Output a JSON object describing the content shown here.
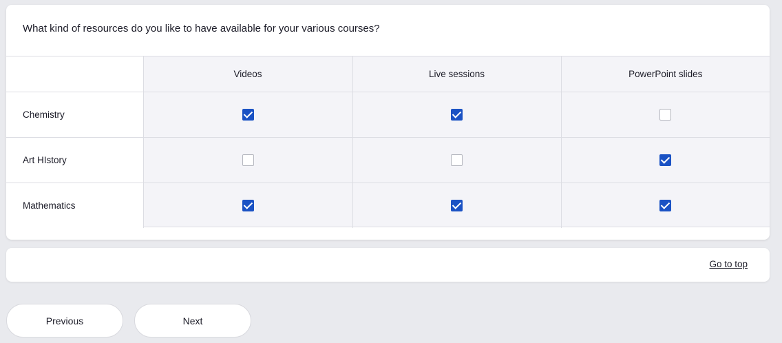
{
  "question": {
    "title": "What kind of resources do you like to have available for your various courses?"
  },
  "matrix": {
    "columns": [
      "Videos",
      "Live sessions",
      "PowerPoint slides"
    ],
    "rows": [
      {
        "label": "Chemistry",
        "values": [
          true,
          true,
          false
        ]
      },
      {
        "label": "Art HIstory",
        "values": [
          false,
          false,
          true
        ]
      },
      {
        "label": "Mathematics",
        "values": [
          true,
          true,
          true
        ]
      }
    ]
  },
  "footer": {
    "go_to_top": "Go to top"
  },
  "navigation": {
    "previous": "Previous",
    "next": "Next"
  },
  "colors": {
    "checked": "#1a52c4",
    "background": "#e9eaee"
  }
}
